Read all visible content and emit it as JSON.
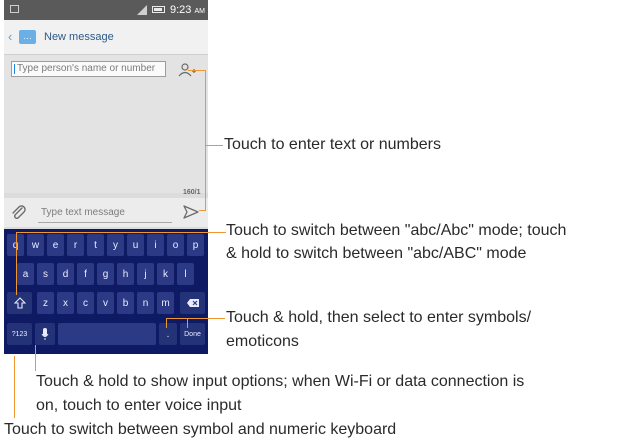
{
  "status_bar": {
    "time": "9:23",
    "time_suffix": "AM"
  },
  "action_bar": {
    "title": "New message",
    "back_icon": "chevron-left-icon",
    "app_icon": "message-icon"
  },
  "compose": {
    "recipient_placeholder": "Type person's name or number",
    "add_contact_icon": "add-contact-icon",
    "char_counter": "160/1",
    "attach_icon": "paperclip-icon",
    "message_placeholder": "Type text message",
    "send_icon": "send-icon"
  },
  "keyboard": {
    "row1": [
      "q",
      "w",
      "e",
      "r",
      "t",
      "y",
      "u",
      "i",
      "o",
      "p"
    ],
    "row2": [
      "a",
      "s",
      "d",
      "f",
      "g",
      "h",
      "j",
      "k",
      "l"
    ],
    "row3": [
      "z",
      "x",
      "c",
      "v",
      "b",
      "n",
      "m"
    ],
    "shift_icon": "shift-icon",
    "delete_icon": "backspace-icon",
    "symbols_label": "?123",
    "mic_icon": "microphone-icon",
    "period_label": ".",
    "done_label": "Done"
  },
  "annotations": {
    "text_field": "Touch to enter text or numbers",
    "shift_line1": "Touch to switch between \"abc/Abc\" mode; touch",
    "shift_line2": "& hold to switch between \"abc/ABC\" mode",
    "symbols_line1": "Touch & hold, then select to enter symbols/",
    "symbols_line2": "emoticons",
    "mic_line1": "Touch & hold to show input options; when Wi-Fi or data connection is",
    "mic_line2": "on, touch to enter voice input",
    "numeric": "Touch to switch between symbol and numeric keyboard"
  },
  "colors": {
    "leader_line": "#f0962e",
    "keyboard_bg": "#0e1a63",
    "key_bg": "#2c3a86",
    "accent": "#5aa0d8"
  }
}
